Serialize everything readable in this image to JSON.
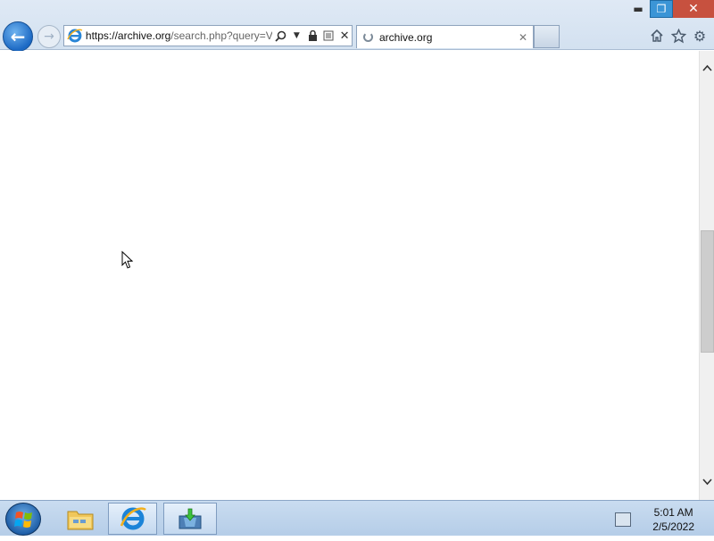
{
  "browser": {
    "window_controls": {
      "minimize": "▬",
      "restore": "❐",
      "close": "✕"
    },
    "address_bar": {
      "url_scheme": "https://",
      "url_host": "archive.org",
      "url_rest": "/search.php?query=V"
    },
    "tab": {
      "title": "archive.org",
      "close": "✕"
    },
    "toolbar_icons": [
      "home-icon",
      "favorites-star-icon",
      "settings-gear-icon"
    ]
  },
  "taskbar": {
    "items": [
      "start-button",
      "file-explorer",
      "internet-explorer",
      "installer"
    ],
    "clock": {
      "time": "5:01 AM",
      "date": "2/5/2022"
    }
  }
}
